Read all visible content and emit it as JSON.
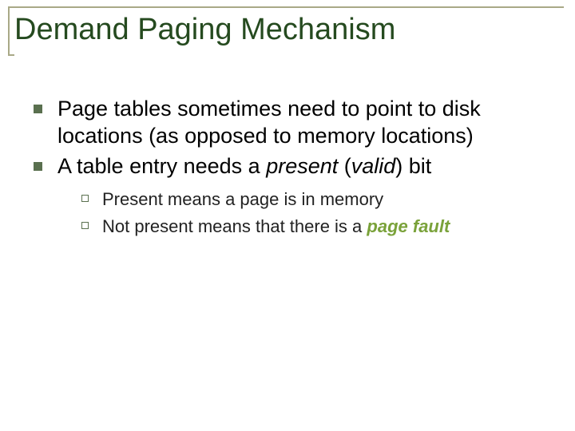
{
  "title": "Demand Paging Mechanism",
  "bullets": [
    {
      "text": "Page tables sometimes need to point to disk locations (as opposed to memory locations)"
    },
    {
      "prefix": "A table entry needs a ",
      "em1": "present",
      "mid": " (",
      "em2": "valid",
      "suffix": ") bit",
      "sub": [
        {
          "text": "Present means a page is in memory"
        },
        {
          "prefix": "Not present means that there is a ",
          "em": "page fault"
        }
      ]
    }
  ]
}
